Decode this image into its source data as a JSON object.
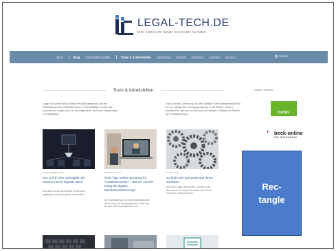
{
  "header": {
    "logo_title": "LEGAL-TECH.DE",
    "logo_tagline": "WIE ANWÄLTE NEUE CHANCEN NUTZEN"
  },
  "nav": {
    "items": [
      {
        "label": "Start",
        "active": false
      },
      {
        "label": "Blog",
        "active": true
      },
      {
        "label": "Geschäftsmodelle",
        "active": false
      },
      {
        "label": "Tools & Arbeitshilfen",
        "active": true
      },
      {
        "label": "Marketing",
        "active": false
      },
      {
        "label": "Partner",
        "active": false
      },
      {
        "label": "Referent",
        "active": false
      },
      {
        "label": "Autoren",
        "active": false
      },
      {
        "label": "Service",
        "active": false
      }
    ],
    "search_label": "Suche"
  },
  "main": {
    "section_title": "Tools & Arbeitshilfen",
    "intro_left": "Legal Tech geht Hand in Hand mit Automatisierung und der Entwicklung neuer Arbeitsprozesse in Kanzleialltag. Kreativ und innovationen sorgen sich um die Möglichkeit, sich neue „Werkzeuge“ zu erschließen.",
    "intro_right": "Doch welches „Werkzeug“ ist das Richtige? Wie Kanzleisoftware Sie hin zur intelligenten Verfolgsgestaltung. In der Rubrik „Tools & Arbeitshilfen“ geht es um die neue und stetigen Software im Bereich der Rechtsberatung.",
    "cards": [
      {
        "date": "17 SEPTEMBER 2020",
        "title": "beA und E-Akte verknüpfen die Kanzlei mit der digitalen Welt",
        "text": "Kanzleien ist das beA wieder in den Blick gegangen und damit gilt für alle Anwälte..."
      },
      {
        "date": "25 AUGUST 2020",
        "title": "Tech-Tipp: Online-Beratung für Anwaltskanzleien – Welche Vorteile bringt die digitale Mandantenbetreuung?",
        "text": "Die Digitalisierung von Geschäftsprozessen macht auch vor Anwaltskanzleien nicht halt. So kann die Kommunikation mit..."
      },
      {
        "date": "11 JULI 2020",
        "title": "So holen Sie das Beste aus Ihrem Workflow",
        "text": "Wer über Legal Tech spricht, benutzt meist Buzzwords wie Smart Contracts oder Smart Contracts, Paris Rechenz..."
      }
    ]
  },
  "sidebar": {
    "partner_label": "Unsere Partner",
    "datev_label": "DATEV",
    "beck_name": "beck-online",
    "beck_sub": "DIE DATENBANK"
  },
  "overlay": {
    "label_line1": "Rec-",
    "label_line2": "tangle",
    "color": "#4a7ccb"
  },
  "colors": {
    "nav_bg": "#6a8aaa",
    "link": "#2b5b9a",
    "datev_green": "#68b42a",
    "beck_red": "#c8102e"
  }
}
